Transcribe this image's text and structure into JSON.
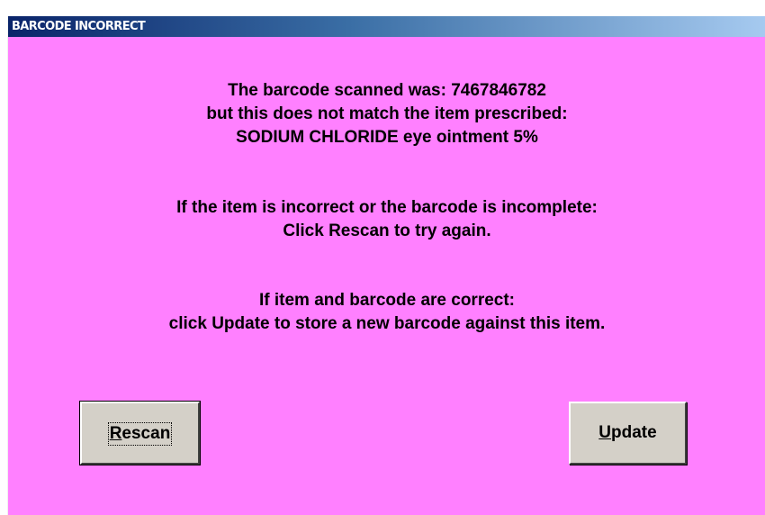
{
  "window": {
    "title": "BARCODE INCORRECT"
  },
  "message": {
    "block1": [
      "The barcode scanned was: 7467846782",
      "but this does not match the item prescribed:",
      "SODIUM CHLORIDE eye ointment 5%"
    ],
    "block2": [
      "If the item is incorrect or the barcode is incomplete:",
      "Click Rescan to try again."
    ],
    "block3": [
      "If item and barcode are correct:",
      "click Update to store a new barcode against this item."
    ]
  },
  "buttons": {
    "rescan": {
      "accel": "R",
      "rest": "escan",
      "focused": true
    },
    "update": {
      "accel": "U",
      "rest": "pdate"
    }
  },
  "colors": {
    "background": "#ff80ff",
    "titlebar_start": "#0a246a",
    "titlebar_end": "#a6caf0",
    "button_face": "#d4d0c8"
  }
}
